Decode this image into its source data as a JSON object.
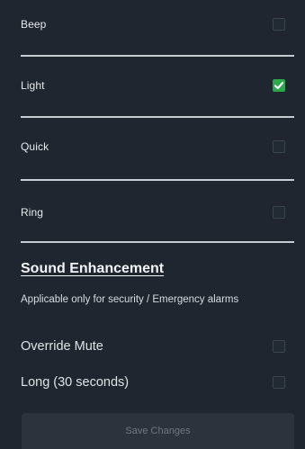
{
  "options": [
    {
      "label": "Beep",
      "checked": false
    },
    {
      "label": "Light",
      "checked": true
    },
    {
      "label": "Quick",
      "checked": false
    },
    {
      "label": "Ring",
      "checked": false
    }
  ],
  "sound_enhancement": {
    "title": "Sound Enhancement",
    "note": "Applicable only for security / Emergency alarms",
    "items": [
      {
        "label": "Override Mute",
        "checked": false
      },
      {
        "label": "Long (30 seconds)",
        "checked": false
      }
    ]
  },
  "save_button": {
    "label": "Save Changes",
    "enabled": false
  },
  "colors": {
    "background": "#1f2630",
    "divider": "#c7ccd3",
    "checkbox_checked": "#2aa84a",
    "button_bg": "#2c333d",
    "button_text": "#6f7782"
  }
}
